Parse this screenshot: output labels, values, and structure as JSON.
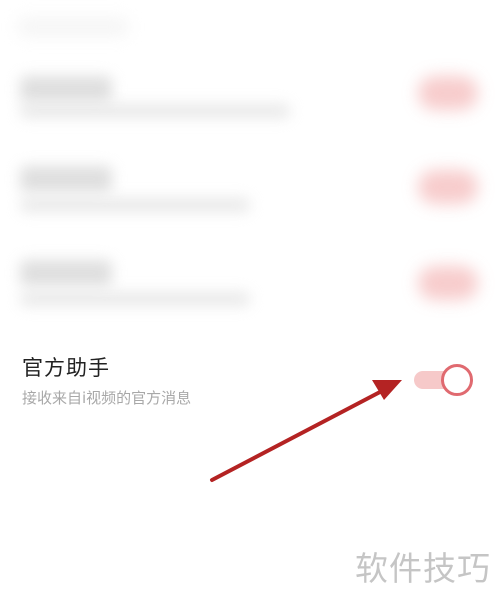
{
  "settings": {
    "official_assistant": {
      "title": "官方助手",
      "subtitle": "接收来自i视频的官方消息",
      "enabled": true
    }
  },
  "colors": {
    "toggle_track": "#f6c9c9",
    "toggle_knob_border": "#e06a70",
    "arrow": "#b42323"
  },
  "watermark": {
    "text": "软件技巧"
  }
}
